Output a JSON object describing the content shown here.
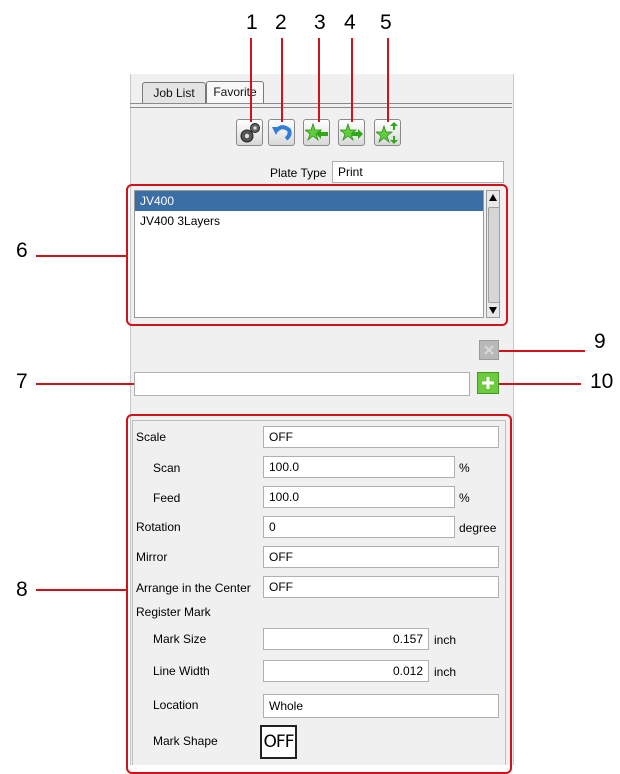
{
  "callouts": [
    "1",
    "2",
    "3",
    "4",
    "5",
    "6",
    "7",
    "8",
    "9",
    "10"
  ],
  "tabs": {
    "job_list": "Job List",
    "favorite": "Favorite"
  },
  "toolbar": {
    "icons": [
      "gears-icon",
      "undo-icon",
      "star-import-icon",
      "star-export-icon",
      "star-move-icon"
    ]
  },
  "plate_type": {
    "label": "Plate Type",
    "value": "Print"
  },
  "favorites_list": {
    "items": [
      "JV400",
      "JV400 3Layers"
    ],
    "selected_index": 0
  },
  "name_input": {
    "value": ""
  },
  "settings": {
    "scale": {
      "label": "Scale",
      "value": "OFF"
    },
    "scan": {
      "label": "Scan",
      "value": "100.0",
      "unit": "%"
    },
    "feed": {
      "label": "Feed",
      "value": "100.0",
      "unit": "%"
    },
    "rotation": {
      "label": "Rotation",
      "value": "0",
      "unit": "degree"
    },
    "mirror": {
      "label": "Mirror",
      "value": "OFF"
    },
    "arrange_center": {
      "label": "Arrange in the Center",
      "value": "OFF"
    },
    "register_mark": {
      "label": "Register Mark"
    },
    "mark_size": {
      "label": "Mark Size",
      "value": "0.157",
      "unit": "inch"
    },
    "line_width": {
      "label": "Line Width",
      "value": "0.012",
      "unit": "inch"
    },
    "location": {
      "label": "Location",
      "value": "Whole"
    },
    "mark_shape": {
      "label": "Mark Shape",
      "value": "OFF"
    }
  },
  "colors": {
    "accent_red": "#d0121b",
    "selection_blue": "#3a6ea5",
    "add_green": "#6ccb3c",
    "star_green": "#5fcf3b"
  }
}
